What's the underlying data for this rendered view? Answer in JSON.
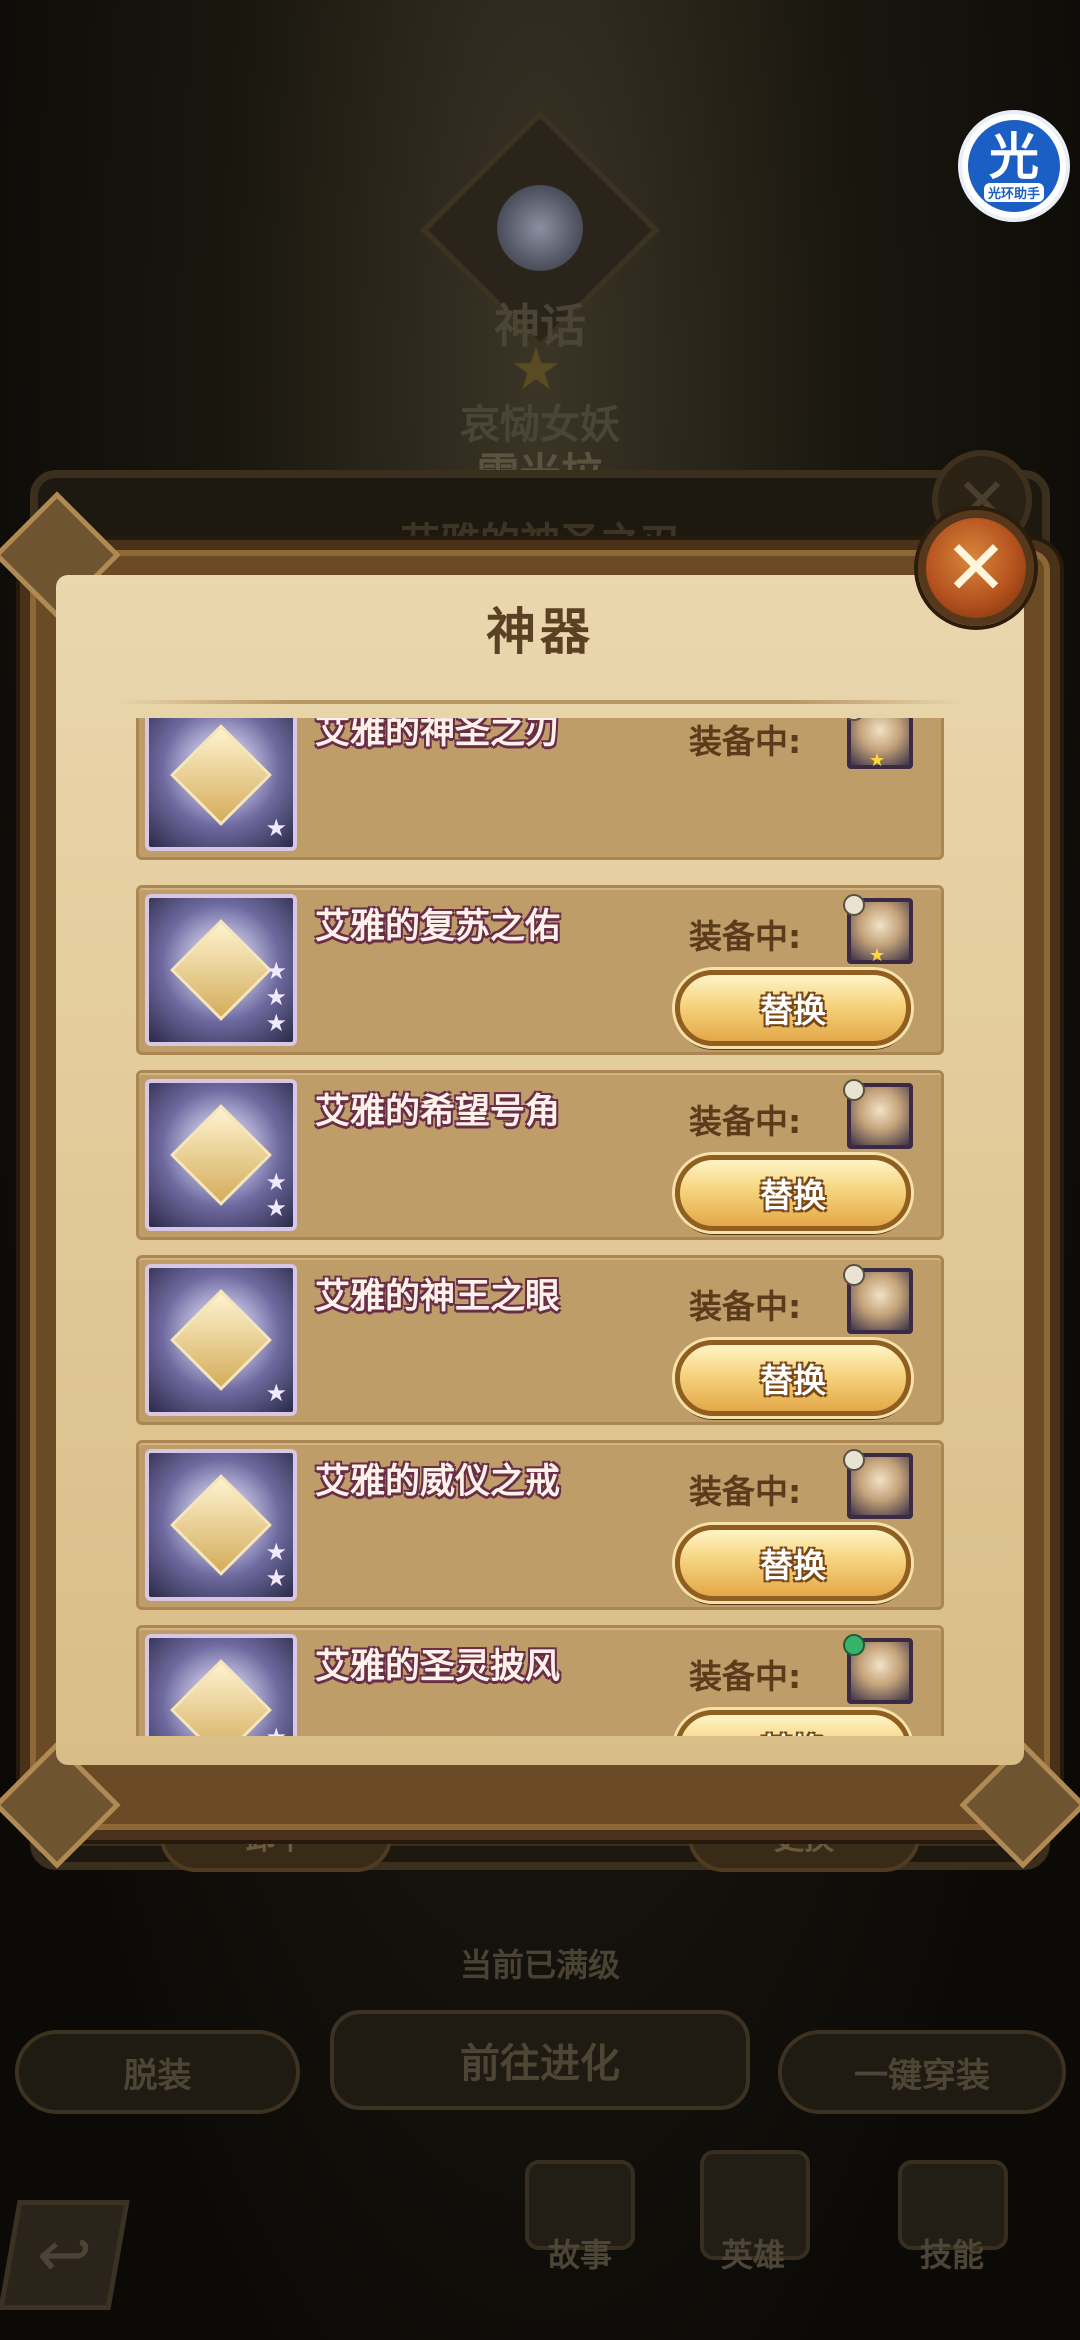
{
  "background": {
    "hero_rarity": "神话",
    "hero_title": "哀恸女妖",
    "hero_name": "雷米拉",
    "back_panel_title": "艾雅的神圣之刃",
    "unequip_label": "卸下",
    "change_label": "更换",
    "max_level_text": "当前已满级",
    "strip_label": "脱装",
    "evolve_label": "前往进化",
    "equip_all_label": "一键穿装",
    "nav": [
      {
        "label": "故事",
        "icon": "book-icon"
      },
      {
        "label": "英雄",
        "icon": "hero-icon"
      },
      {
        "label": "技能",
        "icon": "skill-icon"
      }
    ]
  },
  "helper": {
    "glyph": "光",
    "label": "光环助手"
  },
  "modal": {
    "title": "神器",
    "close_glyph": "✕",
    "equip_label": "装备中:",
    "replace_label": "替换",
    "items": [
      {
        "name": "艾雅的神圣之刃",
        "stars": 1,
        "faction": "light",
        "avatar_star": true,
        "show_replace": false
      },
      {
        "name": "艾雅的复苏之佑",
        "stars": 3,
        "faction": "light",
        "avatar_star": true,
        "show_replace": true
      },
      {
        "name": "艾雅的希望号角",
        "stars": 2,
        "faction": "light",
        "avatar_star": false,
        "show_replace": true
      },
      {
        "name": "艾雅的神王之眼",
        "stars": 1,
        "faction": "light",
        "avatar_star": false,
        "show_replace": true
      },
      {
        "name": "艾雅的威仪之戒",
        "stars": 2,
        "faction": "light",
        "avatar_star": false,
        "show_replace": true
      },
      {
        "name": "艾雅的圣灵披风",
        "stars": 2,
        "faction": "nature",
        "avatar_star": false,
        "show_replace": true
      }
    ]
  },
  "colors": {
    "accent": "#e3a849",
    "title": "#5b4124",
    "item_name_outline": "#6a2d48"
  }
}
